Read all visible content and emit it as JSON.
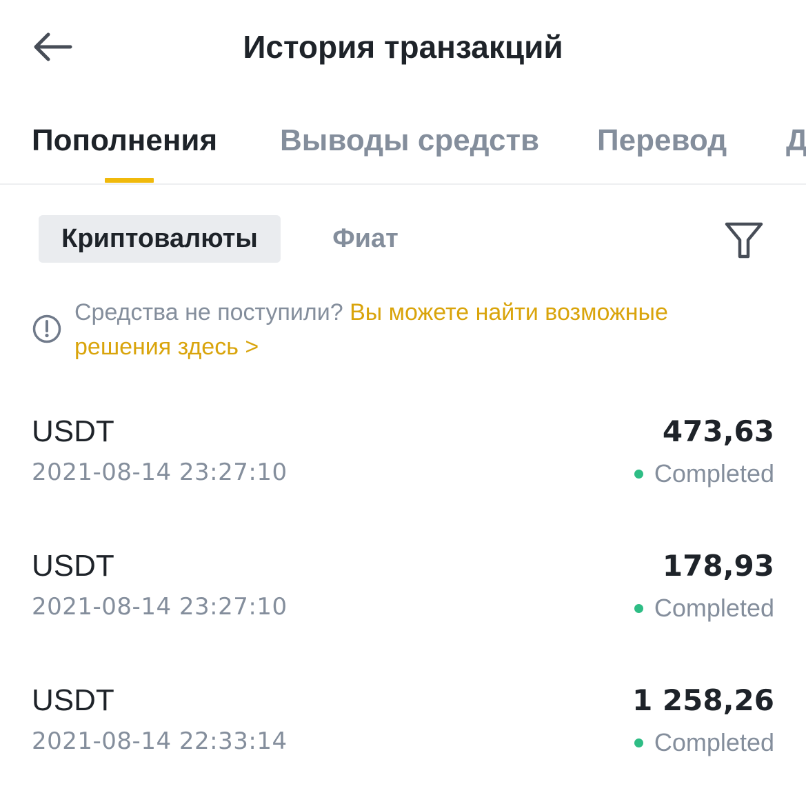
{
  "header": {
    "title": "История транзакций"
  },
  "tabs": [
    {
      "label": "Пополнения",
      "active": true
    },
    {
      "label": "Выводы средств",
      "active": false
    },
    {
      "label": "Перевод",
      "active": false
    },
    {
      "label": "Д",
      "active": false
    }
  ],
  "sub_filter": {
    "crypto_label": "Криптовалюты",
    "fiat_label": "Фиат"
  },
  "notice": {
    "text": "Средства не поступили? ",
    "link_text": "Вы можете найти возможные решения здесь >"
  },
  "transactions": [
    {
      "asset": "USDT",
      "time": "2021-08-14 23:27:10",
      "amount": "473,63",
      "status": "Completed"
    },
    {
      "asset": "USDT",
      "time": "2021-08-14 23:27:10",
      "amount": "178,93",
      "status": "Completed"
    },
    {
      "asset": "USDT",
      "time": "2021-08-14 22:33:14",
      "amount": "1 258,26",
      "status": "Completed"
    }
  ],
  "colors": {
    "accent": "#f0b90b",
    "link": "#d9a40b",
    "status_completed": "#2ebd85",
    "text_primary": "#1e2329",
    "text_secondary": "#848e9c"
  },
  "icons": {
    "back": "arrow-left-icon",
    "filter": "funnel-icon",
    "notice": "exclamation-circle-icon"
  }
}
